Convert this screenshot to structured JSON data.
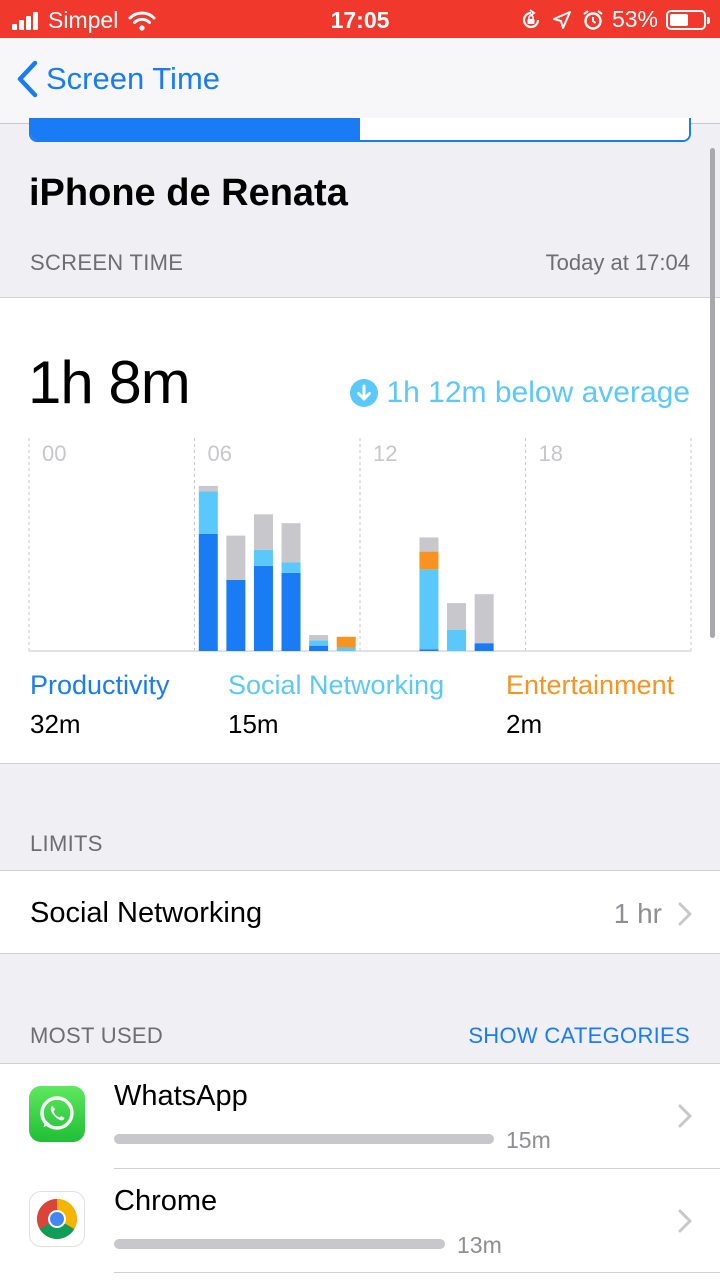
{
  "status": {
    "carrier": "Simpel",
    "time": "17:05",
    "battery": "53%",
    "battery_level": 0.53
  },
  "nav": {
    "back_label": "Screen Time"
  },
  "device_name": "iPhone de Renata",
  "screen_time": {
    "header": "SCREEN TIME",
    "updated": "Today at 17:04",
    "total": "1h 8m",
    "comparison": "1h 12m below average"
  },
  "chart_data": {
    "type": "bar",
    "x_ticks": [
      "00",
      "06",
      "12",
      "18"
    ],
    "hours": [
      6,
      7,
      8,
      9,
      10,
      11,
      14,
      15,
      16
    ],
    "series": [
      {
        "name": "Productivity",
        "color": "#1a7cf5",
        "values": [
          33,
          20,
          24,
          22,
          1.5,
          0,
          0.5,
          0,
          2.2
        ]
      },
      {
        "name": "Social Networking",
        "color": "#5ac8fa",
        "values": [
          12,
          0,
          4.5,
          3,
          1.5,
          1,
          22.5,
          6,
          0
        ]
      },
      {
        "name": "Entertainment",
        "color": "#f7931e",
        "values": [
          0,
          0,
          0,
          0,
          0,
          3,
          5,
          0,
          0
        ]
      },
      {
        "name": "Other",
        "color": "#c7c7cc",
        "values": [
          1.5,
          12.5,
          10,
          11,
          1.5,
          0,
          4,
          7.5,
          13.8
        ]
      }
    ],
    "ylim": [
      0,
      60
    ]
  },
  "categories": [
    {
      "name": "Productivity",
      "value": "32m",
      "color": "#1a7cf5"
    },
    {
      "name": "Social Networking",
      "value": "15m",
      "color": "#5ac8fa"
    },
    {
      "name": "Entertainment",
      "value": "2m",
      "color": "#f7931e"
    }
  ],
  "limits": {
    "header": "LIMITS",
    "items": [
      {
        "label": "Social Networking",
        "value": "1 hr"
      }
    ]
  },
  "most_used": {
    "header": "MOST USED",
    "action": "SHOW CATEGORIES",
    "apps": [
      {
        "name": "WhatsApp",
        "time": "15m",
        "fraction": 1.0,
        "icon": "whatsapp-icon"
      },
      {
        "name": "Chrome",
        "time": "13m",
        "fraction": 0.87,
        "icon": "chrome-icon"
      }
    ]
  },
  "colors": {
    "accent": "#1a7cf5",
    "status_bar": "#f0382c",
    "below_avg": "#5ac8fa"
  }
}
